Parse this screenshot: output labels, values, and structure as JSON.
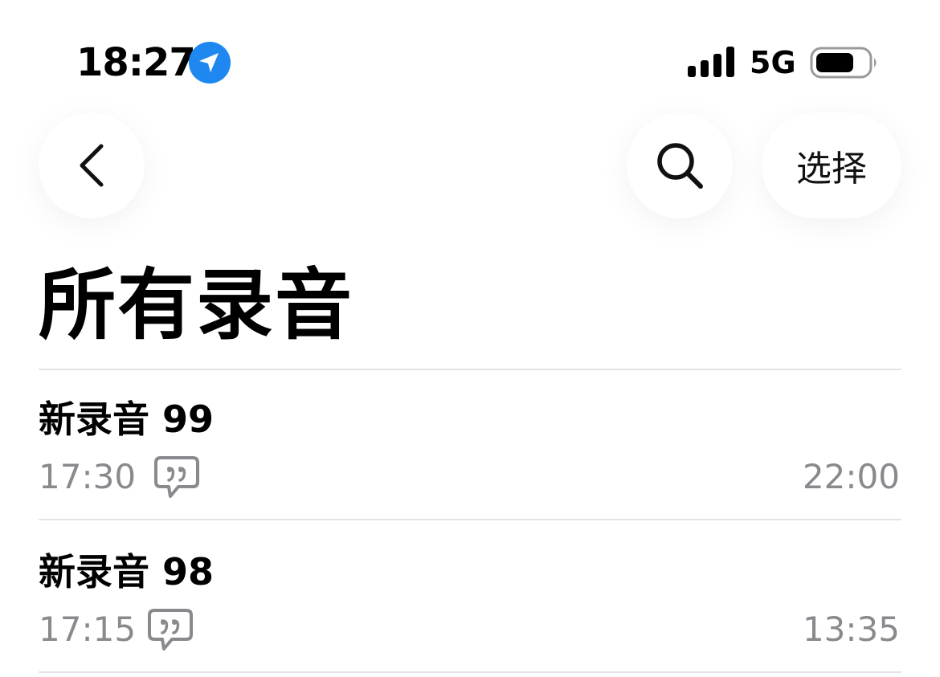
{
  "status_bar": {
    "time": "18:27",
    "network": "5G",
    "icons": [
      "location-arrow-icon",
      "signal-bars-icon",
      "battery-icon"
    ]
  },
  "nav": {
    "back_icon": "chevron-left-icon",
    "search_icon": "magnifier-icon",
    "select_label": "选择"
  },
  "page": {
    "title": "所有录音"
  },
  "recordings": [
    {
      "title": "新录音 99",
      "time": "17:30",
      "duration": "22:00",
      "icon": "transcript-quote-icon"
    },
    {
      "title": "新录音 98",
      "time": "17:15",
      "duration": "13:35",
      "icon": "transcript-quote-icon"
    }
  ],
  "colors": {
    "accent_blue": "#1E88F0",
    "secondary_text": "#8A8A8E",
    "divider": "#E3E3E6"
  }
}
